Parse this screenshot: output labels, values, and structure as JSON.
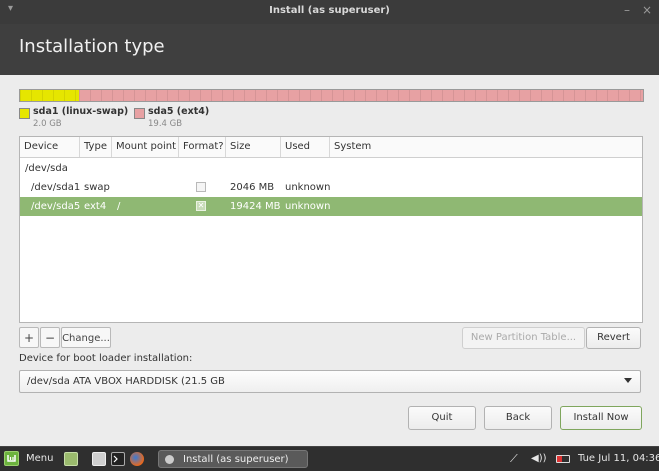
{
  "window": {
    "title": "Install (as superuser)",
    "minimize": "–",
    "close": "×",
    "menu_arrow": "▾"
  },
  "page_title": "Installation type",
  "colors": {
    "swap": "#e6e600",
    "ext4": "#e7a1a3",
    "selected_row": "#8fb873",
    "accent": "#87cf3e"
  },
  "partition_map": [
    {
      "name": "sda1",
      "fraction": 0.095,
      "color": "#e6e600"
    },
    {
      "name": "sda5",
      "fraction": 0.905,
      "color": "#e7a1a3"
    }
  ],
  "legend": [
    {
      "label": "sda1 (linux-swap)",
      "size": "2.0 GB"
    },
    {
      "label": "sda5 (ext4)",
      "size": "19.4 GB"
    }
  ],
  "table": {
    "columns": [
      "Device",
      "Type",
      "Mount point",
      "Format?",
      "Size",
      "Used",
      "System"
    ],
    "rows": [
      {
        "device": "/dev/sda",
        "type": "",
        "mount": "",
        "format": "",
        "size": "",
        "used": "",
        "system": ""
      },
      {
        "device": "/dev/sda1",
        "type": "swap",
        "mount": "",
        "format": "",
        "size": "2046 MB",
        "used": "unknown",
        "system": ""
      },
      {
        "device": "/dev/sda5",
        "type": "ext4",
        "mount": "/",
        "format": "✕",
        "size": "19424 MB",
        "used": "unknown",
        "system": ""
      }
    ]
  },
  "toolbar": {
    "add": "+",
    "remove": "−",
    "change": "Change...",
    "new_table": "New Partition Table...",
    "revert": "Revert"
  },
  "boot_loader": {
    "label": "Device for boot loader installation:",
    "value": "/dev/sda   ATA VBOX HARDDISK (21.5 GB"
  },
  "buttons": {
    "quit": "Quit",
    "back": "Back",
    "install": "Install Now"
  },
  "taskbar": {
    "menu": "Menu",
    "task": "Install (as superuser)",
    "clock": "Tue Jul 11, 04:36",
    "icons": [
      "mint-logo-icon",
      "terminal-icon",
      "files-icon",
      "firefox-icon",
      "network-icon",
      "volume-icon",
      "battery-icon"
    ]
  }
}
